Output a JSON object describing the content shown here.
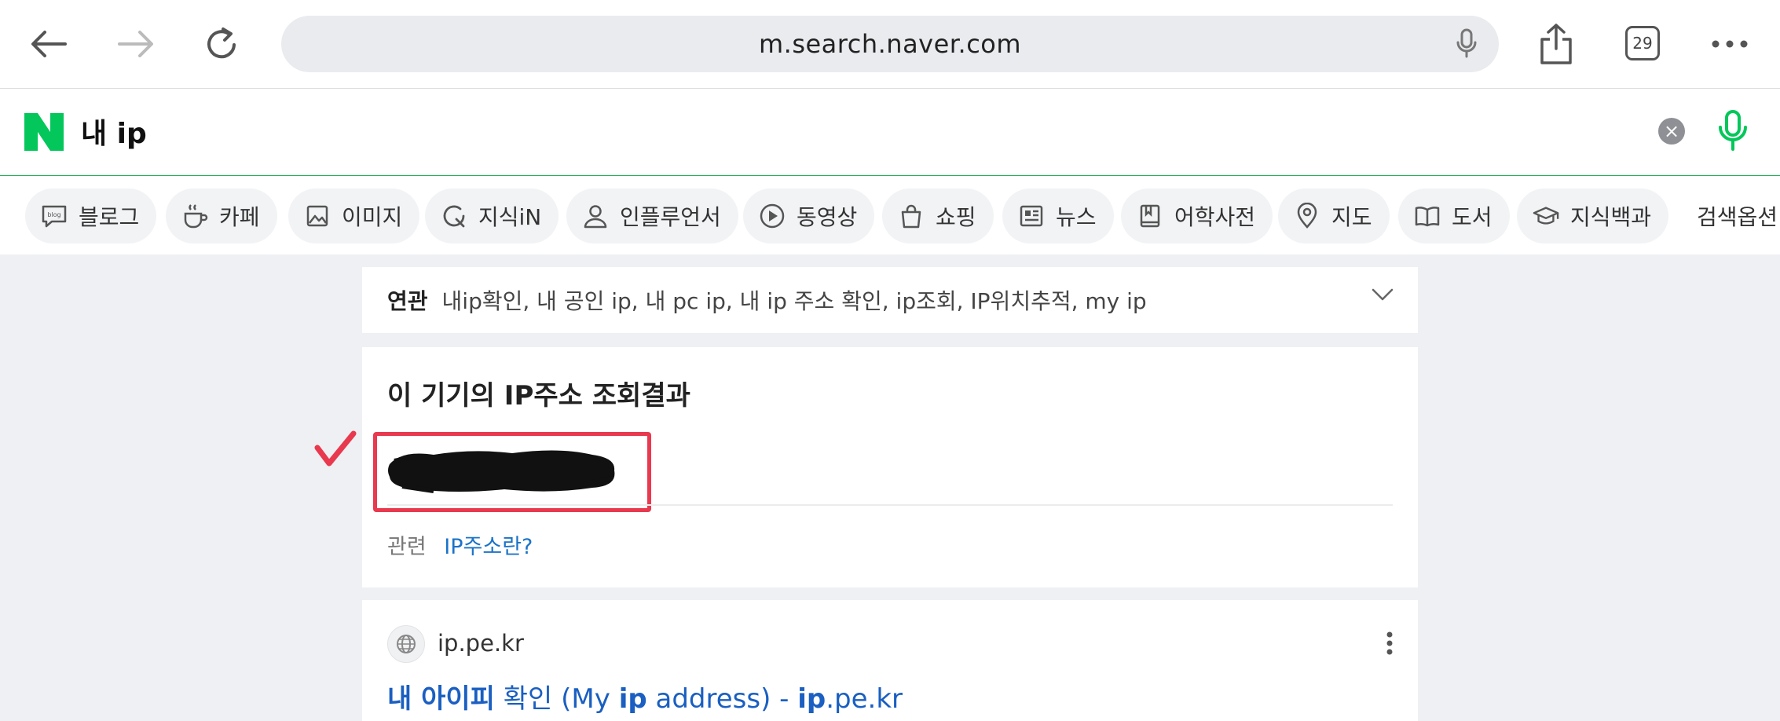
{
  "browser": {
    "url": "m.search.naver.com",
    "tab_count": "29"
  },
  "search": {
    "query": "내 ip"
  },
  "tabs": [
    {
      "label": "블로그",
      "icon": "blog-icon"
    },
    {
      "label": "카페",
      "icon": "cafe-cup-icon"
    },
    {
      "label": "이미지",
      "icon": "image-icon"
    },
    {
      "label": "지식iN",
      "icon": "kin-q-icon"
    },
    {
      "label": "인플루언서",
      "icon": "person-icon"
    },
    {
      "label": "동영상",
      "icon": "play-icon"
    },
    {
      "label": "쇼핑",
      "icon": "shopping-bag-icon"
    },
    {
      "label": "뉴스",
      "icon": "news-icon"
    },
    {
      "label": "어학사전",
      "icon": "dictionary-icon"
    },
    {
      "label": "지도",
      "icon": "map-pin-icon"
    },
    {
      "label": "도서",
      "icon": "book-icon"
    },
    {
      "label": "지식백과",
      "icon": "graduation-cap-icon"
    },
    {
      "label": "검색옵션",
      "icon": ""
    }
  ],
  "related": {
    "label": "연관",
    "keywords": "내ip확인, 내 공인 ip, 내 pc ip, 내 ip 주소 확인, ip조회, IP위치추적, my ip"
  },
  "ip_result": {
    "title": "이 기기의 IP주소 조회결과",
    "related_label": "관련",
    "related_link": "IP주소란?"
  },
  "result": {
    "site": "ip.pe.kr",
    "title_parts": [
      "내 아이피",
      " 확인 (My ",
      "ip",
      " address) - ",
      "ip",
      ".pe.kr"
    ]
  },
  "colors": {
    "naver_green": "#03c75a",
    "link_blue": "#1a5fc1",
    "highlight_red": "#e8394f"
  }
}
